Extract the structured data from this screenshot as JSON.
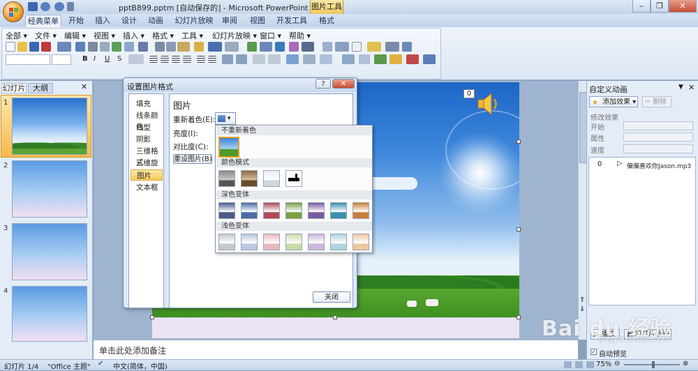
{
  "window": {
    "title": "pptB899.pptm [自动保存的] - Microsoft PowerPoint",
    "context_tab": "图片工具"
  },
  "ribbon_tabs": [
    "经典菜单",
    "开始",
    "插入",
    "设计",
    "动画",
    "幻灯片放映",
    "审阅",
    "视图",
    "开发工具",
    "格式"
  ],
  "menus": [
    "全部",
    "文件",
    "编辑",
    "视图",
    "插入",
    "格式",
    "工具",
    "幻灯片放映",
    "窗口",
    "帮助"
  ],
  "panel_tabs": {
    "slides": "幻灯片",
    "outline": "大纲"
  },
  "slide_numbers": [
    "1",
    "2",
    "3",
    "4"
  ],
  "slide_badge": "0",
  "notes_placeholder": "单击此处添加备注",
  "dialog": {
    "title": "设置图片格式",
    "help": "?",
    "nav": [
      "填充",
      "线条颜色",
      "线型",
      "阴影",
      "三维格式",
      "三维旋转",
      "图片",
      "文本框"
    ],
    "section_title": "图片",
    "recolor_label": "重新着色(E):",
    "brightness_label": "亮度(I):",
    "contrast_label": "对比度(C):",
    "reset_button": "重设图片(B)",
    "close_button": "关闭"
  },
  "recolor_dropdown": {
    "no_recolor": "不重新着色",
    "color_modes": "颜色模式",
    "dark_variants": "深色变体",
    "light_variants": "浅色变体",
    "dark_colors": [
      "#4a5a8a",
      "#4c6ca8",
      "#b04a5a",
      "#7aa040",
      "#7a5aa0",
      "#3a90b0",
      "#c8803a"
    ],
    "light_colors": [
      "#c4c8d0",
      "#b8c8e0",
      "#e8b8c0",
      "#c8dca8",
      "#cbb8dc",
      "#b0d4e4",
      "#ecc8a0"
    ]
  },
  "task_pane": {
    "title": "自定义动画",
    "add_effect": "添加效果",
    "remove": "删除",
    "modify_effect": "修改效果",
    "start": "开始",
    "property": "属性",
    "speed": "速度",
    "anim_index": "0",
    "anim_item": "偏偏喜欢你Jason.mp3",
    "play_button": "播放",
    "slideshow_button": "幻灯片放映",
    "autopreview": "自动预览"
  },
  "status": {
    "slide_info": "幻灯片 1/4",
    "theme": "\"Office 主题\"",
    "language": "中文(简体，中国)",
    "zoom": "75%"
  },
  "watermark": {
    "brand": "Bai du 经验",
    "url": "jingyan.baidu.com"
  }
}
